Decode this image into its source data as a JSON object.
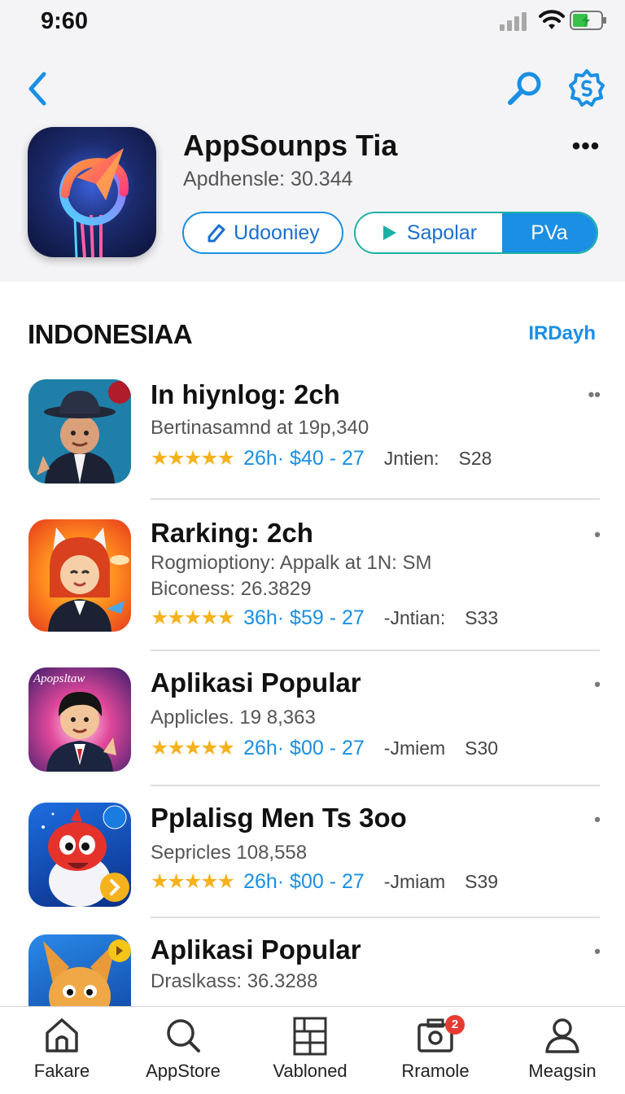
{
  "status_bar": {
    "time": "9:60"
  },
  "header": {
    "app_title": "AppSounps Tia",
    "app_subtitle": "Apdhensle: 30.344",
    "pill_label": "Udooniey",
    "segment_left_label": "Sapolar",
    "segment_right_label": "PVa",
    "accent_color": "#1a8fe3"
  },
  "section": {
    "title": "INDONESIAA",
    "link": "IRDayh"
  },
  "items": [
    {
      "title": "In hiynlog: 2ch",
      "sub1": "Bertinasamnd at 19p,340",
      "sub2": "",
      "price": "26h· $40 - 27",
      "label": "Jntien:",
      "code": "S28",
      "icon": "man-in-hat-avatar"
    },
    {
      "title": "Rarking: 2ch",
      "sub1": "Rogmioptiony: Appalk at 1N: SM",
      "sub2": "Biconess: 26.3829",
      "price": "36h· $59 - 27",
      "label": "-Jntian:",
      "code": "S33",
      "icon": "fox-girl-avatar"
    },
    {
      "title": "Aplikasi Popular",
      "sub1": "Applicles. 19 8,363",
      "sub2": "",
      "price": "26h· $00 - 27",
      "label": "-Jmiem",
      "code": "S30",
      "icon": "boy-avatar"
    },
    {
      "title": "Pplalisg Men Ts 3oo",
      "sub1": "Sepricles 108,558",
      "sub2": "",
      "price": "26h· $00 - 27",
      "label": "-Jmiam",
      "code": "S39",
      "icon": "red-bird-avatar"
    },
    {
      "title": "Aplikasi Popular",
      "sub1": "Draslkass: 36.3288",
      "sub2": "",
      "price": "",
      "label": "",
      "code": "",
      "icon": "bunny-avatar"
    }
  ],
  "tabs": [
    {
      "label": "Fakare",
      "icon": "home-icon"
    },
    {
      "label": "AppStore",
      "icon": "search-icon"
    },
    {
      "label": "Vabloned",
      "icon": "grid-icon"
    },
    {
      "label": "Rramole",
      "icon": "camera-icon",
      "badge": "2"
    },
    {
      "label": "Meagsin",
      "icon": "person-icon"
    }
  ]
}
